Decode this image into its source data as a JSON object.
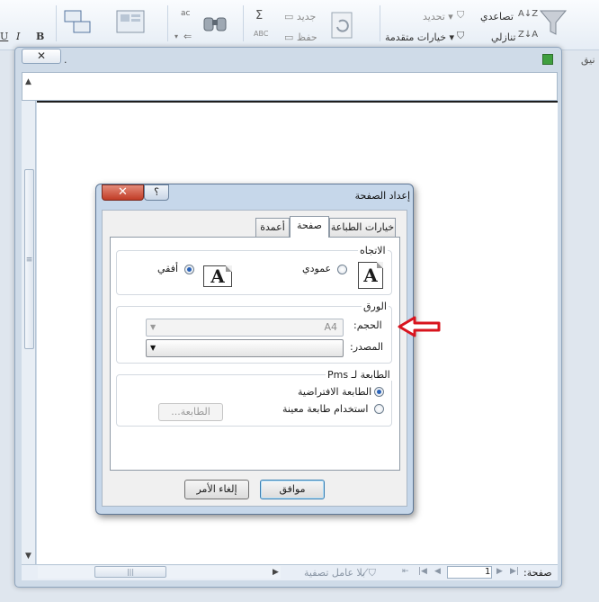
{
  "ribbon": {
    "sort_asc": "تصاعدي",
    "sort_desc": "تنازلي",
    "select": "تحديد",
    "advanced_options": "خيارات متقدمة",
    "new": "جديد",
    "save": "حفظ",
    "sigma": "Σ",
    "abc": "ABC",
    "ac": "ac",
    "font_bold": "B",
    "font_italic": "I",
    "font_underline": "U",
    "edge_text_1": "نيق",
    "edge_text_2": "ي"
  },
  "background_window": {
    "close_label": "✕",
    "dot": "."
  },
  "dialog": {
    "title": "إعداد الصفحة",
    "close_label": "✕",
    "help_label": "؟",
    "tabs": [
      {
        "label": "خيارات الطباعة"
      },
      {
        "label": "صفحة"
      },
      {
        "label": "أعمدة"
      }
    ],
    "orientation": {
      "label": "الاتجاه",
      "portrait": "عمودي",
      "landscape": "أفقي",
      "icon_letter": "A"
    },
    "paper": {
      "label": "الورق",
      "size_label": "الحجم:",
      "size_value": "A4",
      "source_label": "المصدر:"
    },
    "printer": {
      "label": "الطابعة لـ Pms",
      "default_printer": "الطابعة الافتراضية",
      "specific_printer": "استخدام طابعة معينة",
      "printer_button": "الطابعة..."
    },
    "ok_button": "موافق",
    "cancel_button": "إلغاء الأمر"
  },
  "status_bar": {
    "page_label": "صفحة:",
    "page_number": "1",
    "filter_text": "بلا عامل تصفية"
  }
}
